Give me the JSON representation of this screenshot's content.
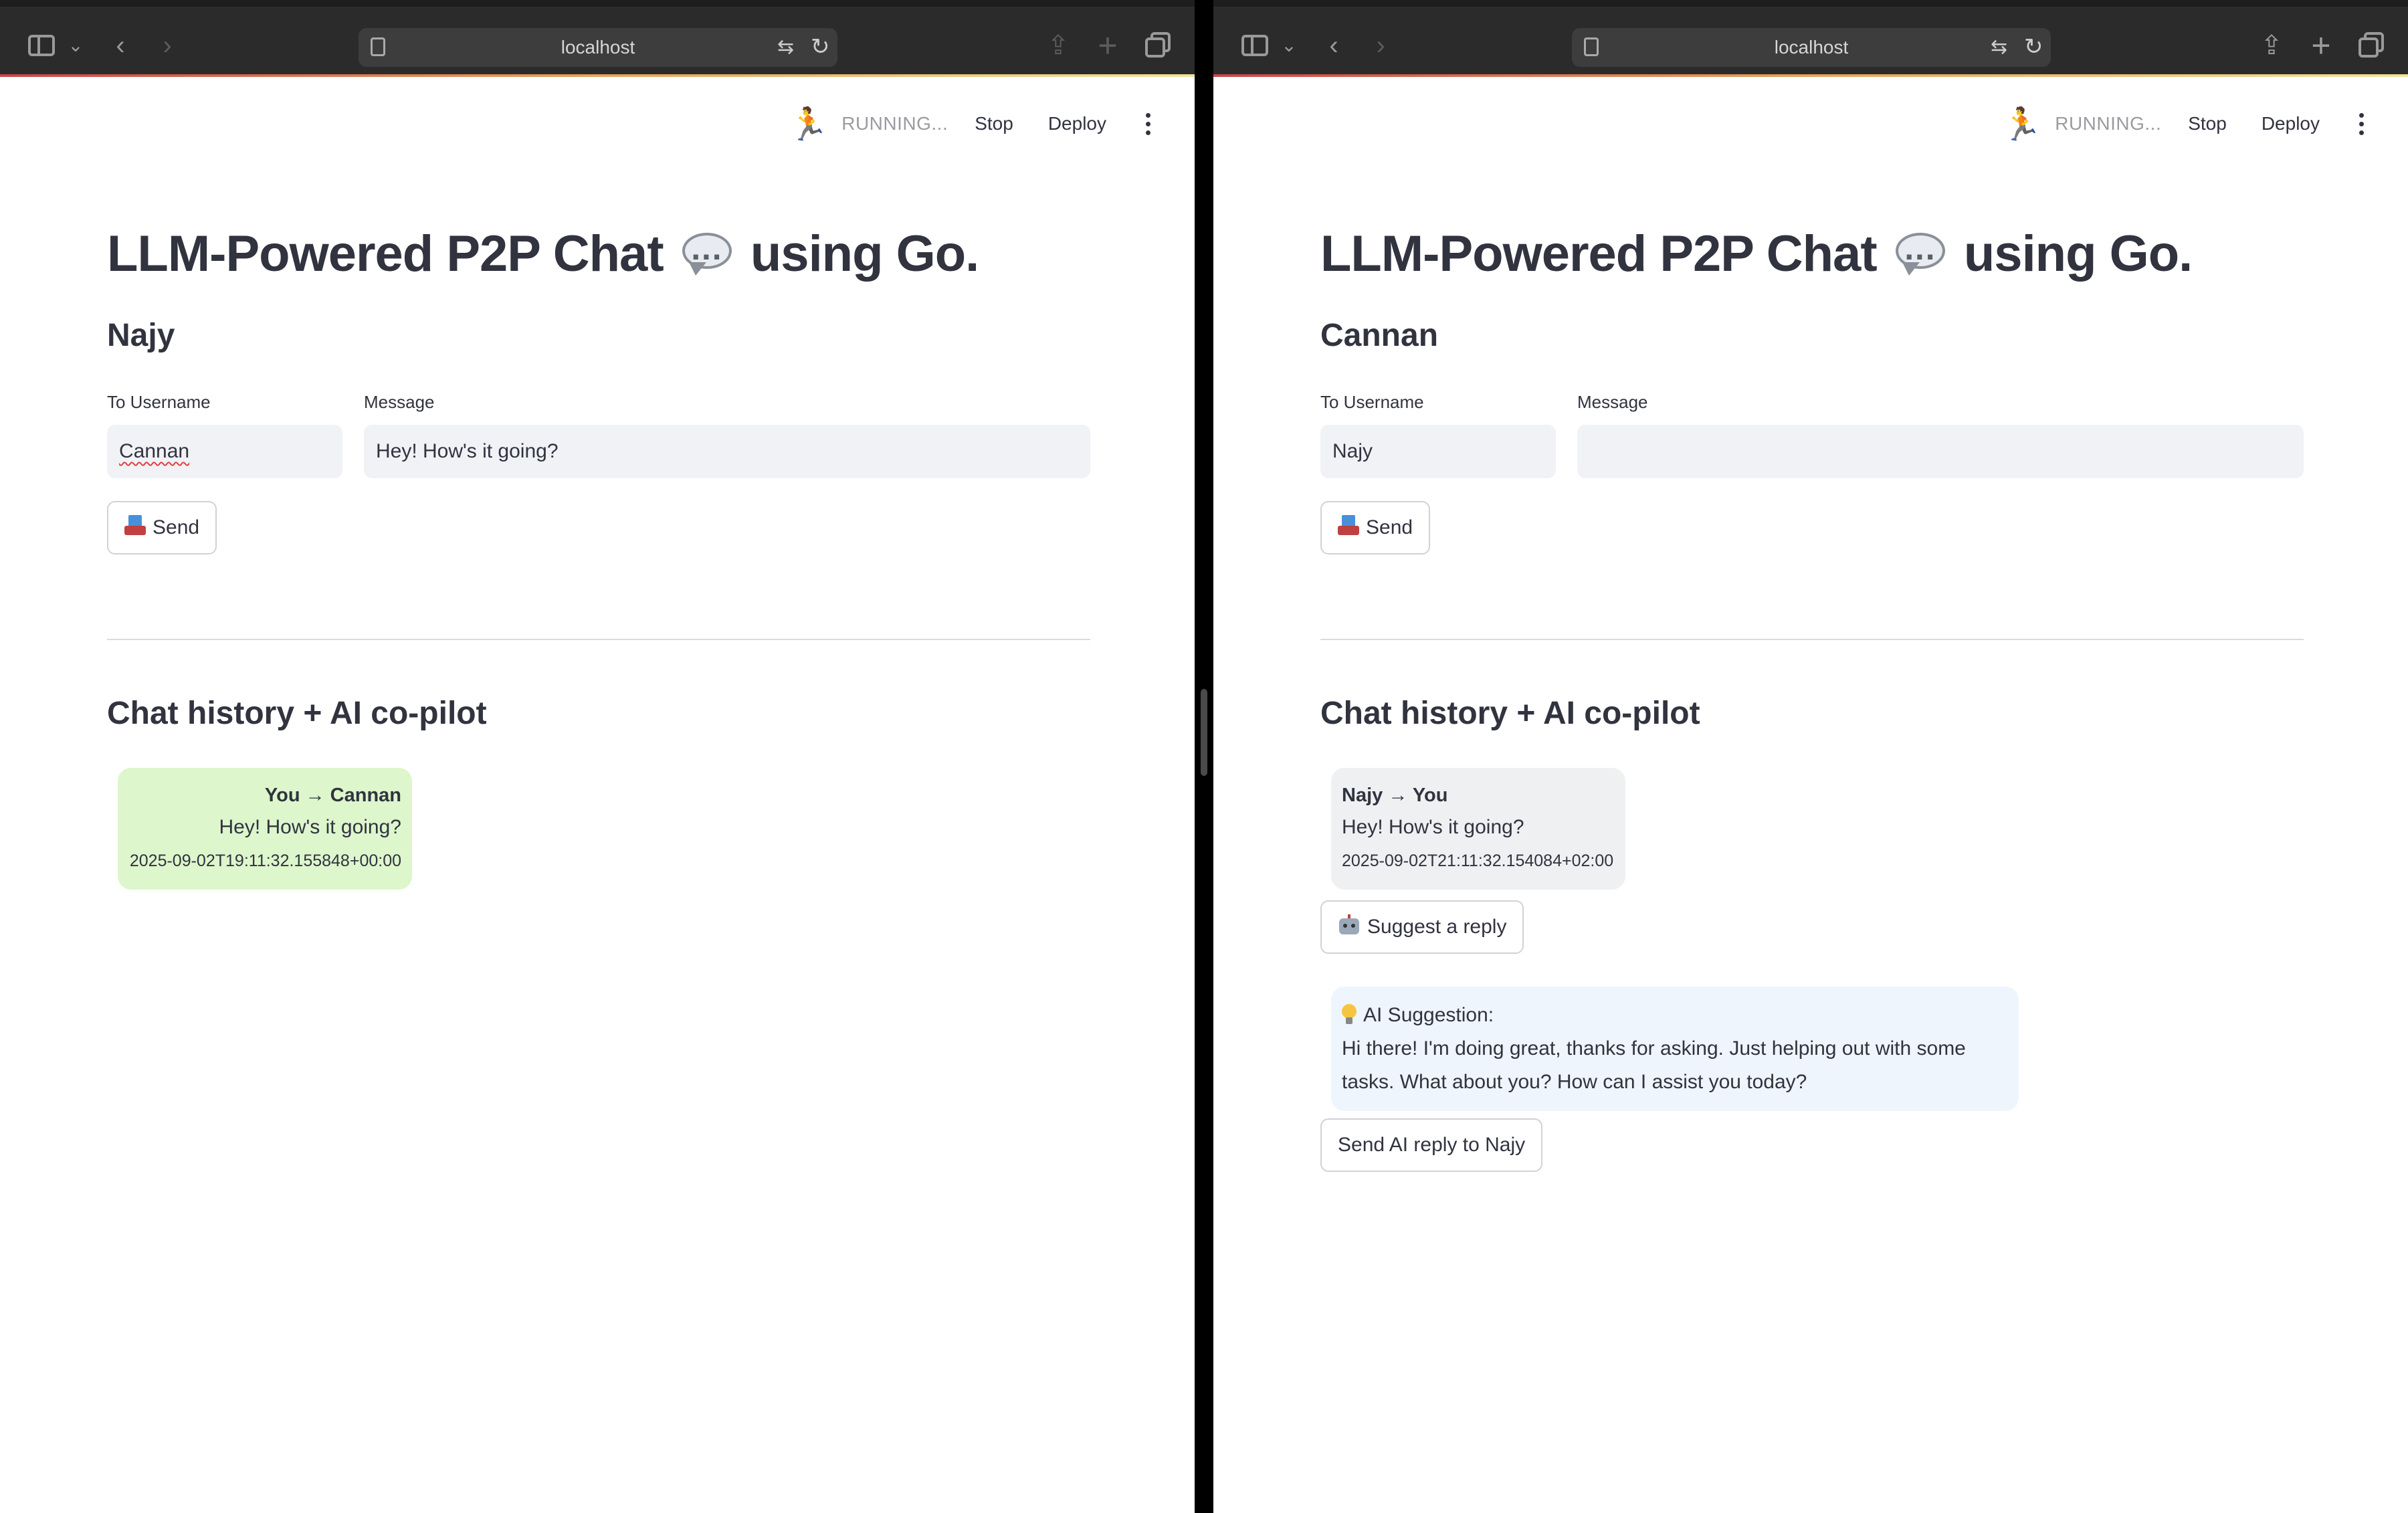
{
  "browser": {
    "url": "localhost"
  },
  "toolbar": {
    "status": "RUNNING...",
    "stop_label": "Stop",
    "deploy_label": "Deploy"
  },
  "app": {
    "title_left": "LLM-Powered P2P Chat",
    "title_right": "using Go.",
    "to_label": "To Username",
    "message_label": "Message",
    "send_label": "Send",
    "section_title": "Chat history + AI co-pilot"
  },
  "left": {
    "username": "Najy",
    "to_value": "Cannan",
    "message_value": "Hey! How's it going?",
    "history": [
      {
        "from_to": "You → Cannan",
        "text": "Hey! How's it going?",
        "timestamp": "2025-09-02T19:11:32.155848+00:00"
      }
    ]
  },
  "right": {
    "username": "Cannan",
    "to_value": "Najy",
    "message_value": "",
    "history": [
      {
        "from_to": "Najy → You",
        "text": "Hey! How's it going?",
        "timestamp": "2025-09-02T21:11:32.154084+02:00"
      }
    ],
    "suggest_label": "Suggest a reply",
    "ai_title": "AI Suggestion:",
    "ai_text": "Hi there! I'm doing great, thanks for asking. Just helping out with some tasks. What about you? How can I assist you today?",
    "send_ai_label": "Send AI reply to Najy"
  },
  "colors": {
    "sent_bubble": "#ddf6cc",
    "received_bubble": "#eff0f2",
    "ai_box": "#eef5fd",
    "text": "#31333f"
  }
}
